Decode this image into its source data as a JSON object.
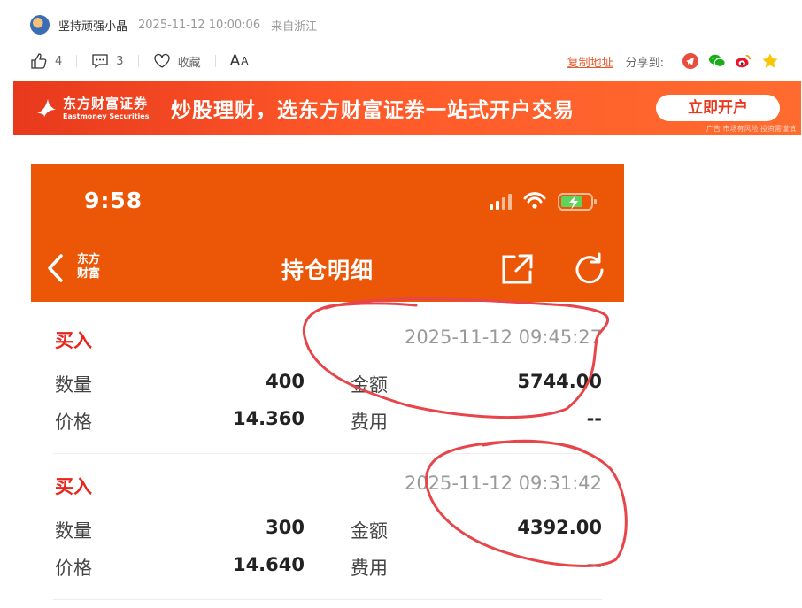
{
  "author": {
    "name": "坚持顽强小晶",
    "time": "2025-11-12 10:00:06",
    "location": "来自浙江"
  },
  "actions": {
    "likes": "4",
    "comments": "3",
    "favorite_label": "收藏",
    "font_big": "A",
    "font_small": "A",
    "copy_link": "复制地址",
    "share_label": "分享到:"
  },
  "share_icons": [
    "telegram-icon",
    "wechat-icon",
    "weibo-icon",
    "star-icon"
  ],
  "ad": {
    "brand_cn": "东方财富证券",
    "brand_en": "Eastmoney Securities",
    "slogan": "炒股理财，选东方财富证券一站式开户交易",
    "button": "立即开户",
    "note": "广告 市场有风险 投资需谨慎"
  },
  "phone": {
    "time": "9:58",
    "nav_brand_1": "东方",
    "nav_brand_2": "财富",
    "title": "持仓明细",
    "records": [
      {
        "type": "买入",
        "datetime": "2025-11-12 09:45:27",
        "qty_label": "数量",
        "qty": "400",
        "amount_label": "金额",
        "amount": "5744.00",
        "price_label": "价格",
        "price": "14.360",
        "fee_label": "费用",
        "fee": "--"
      },
      {
        "type": "买入",
        "datetime": "2025-11-12 09:31:42",
        "qty_label": "数量",
        "qty": "300",
        "amount_label": "金额",
        "amount": "4392.00",
        "price_label": "价格",
        "price": "14.640",
        "fee_label": "费用",
        "fee": "--"
      }
    ]
  },
  "colors": {
    "brand_orange": "#eb5607",
    "buy_red": "#e8251b",
    "annotation_red": "#e8454a",
    "link": "#e05a2b"
  }
}
